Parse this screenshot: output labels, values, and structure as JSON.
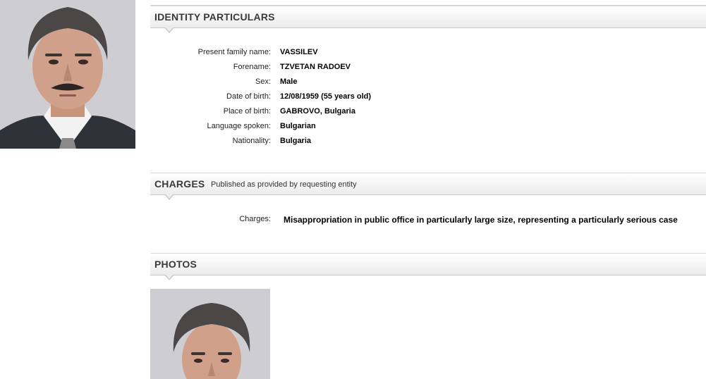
{
  "identity": {
    "heading": "IDENTITY PARTICULARS",
    "fields": [
      {
        "label": "Present family name:",
        "value": "VASSILEV"
      },
      {
        "label": "Forename:",
        "value": "TZVETAN RADOEV"
      },
      {
        "label": "Sex:",
        "value": "Male"
      },
      {
        "label": "Date of birth:",
        "value": "12/08/1959 (55 years old)"
      },
      {
        "label": "Place of birth:",
        "value": "GABROVO, Bulgaria"
      },
      {
        "label": "Language spoken:",
        "value": "Bulgarian"
      },
      {
        "label": "Nationality:",
        "value": "Bulgaria"
      }
    ]
  },
  "charges": {
    "heading": "CHARGES",
    "subtitle": "Published as provided by requesting entity",
    "label": "Charges:",
    "value": "Misappropriation in public office in particularly large size, representing a particularly serious case"
  },
  "photos": {
    "heading": "PHOTOS"
  },
  "colors": {
    "header_gradient_end": "#ececec",
    "photo_background": "#cfcfd3"
  }
}
